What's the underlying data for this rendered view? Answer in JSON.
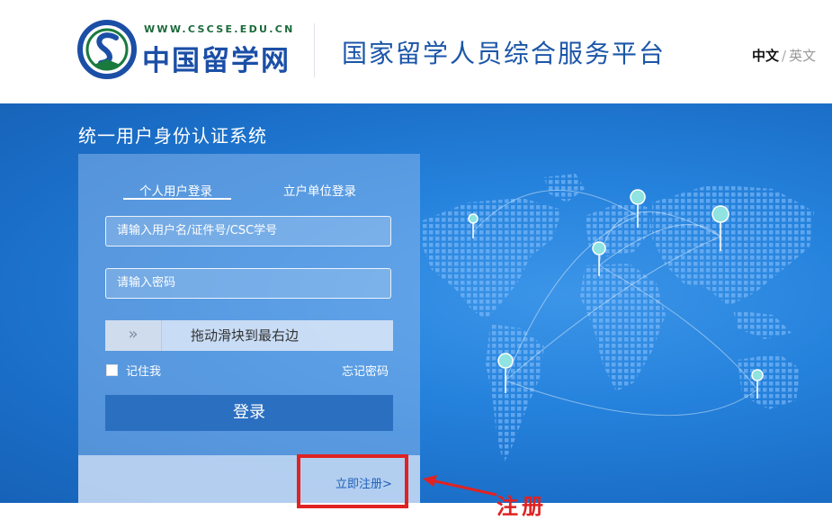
{
  "header": {
    "logo_url": "WWW.CSCSE.EDU.CN",
    "logo_name": "中国留学网",
    "site_title": "国家留学人员综合服务平台",
    "lang_current": "中文",
    "lang_separator": "/",
    "lang_other": "英文"
  },
  "banner": {
    "system_title": "统一用户身份认证系统"
  },
  "login": {
    "tabs": [
      {
        "label": "个人用户登录",
        "active": true
      },
      {
        "label": "立户单位登录",
        "active": false
      }
    ],
    "username_placeholder": "请输入用户名/证件号/CSC学号",
    "password_placeholder": "请输入密码",
    "slider_handle": "»",
    "slider_text": "拖动滑块到最右边",
    "remember_label": "记住我",
    "forgot_label": "忘记密码",
    "submit_label": "登录",
    "register_label": "立即注册>"
  },
  "annotation": {
    "text": "注册",
    "color": "#e02222"
  },
  "colors": {
    "brand_blue": "#1b56a8",
    "banner_blue": "#2582dc",
    "button_blue": "#2b6fc1",
    "pin_color": "#8fe3e0"
  }
}
